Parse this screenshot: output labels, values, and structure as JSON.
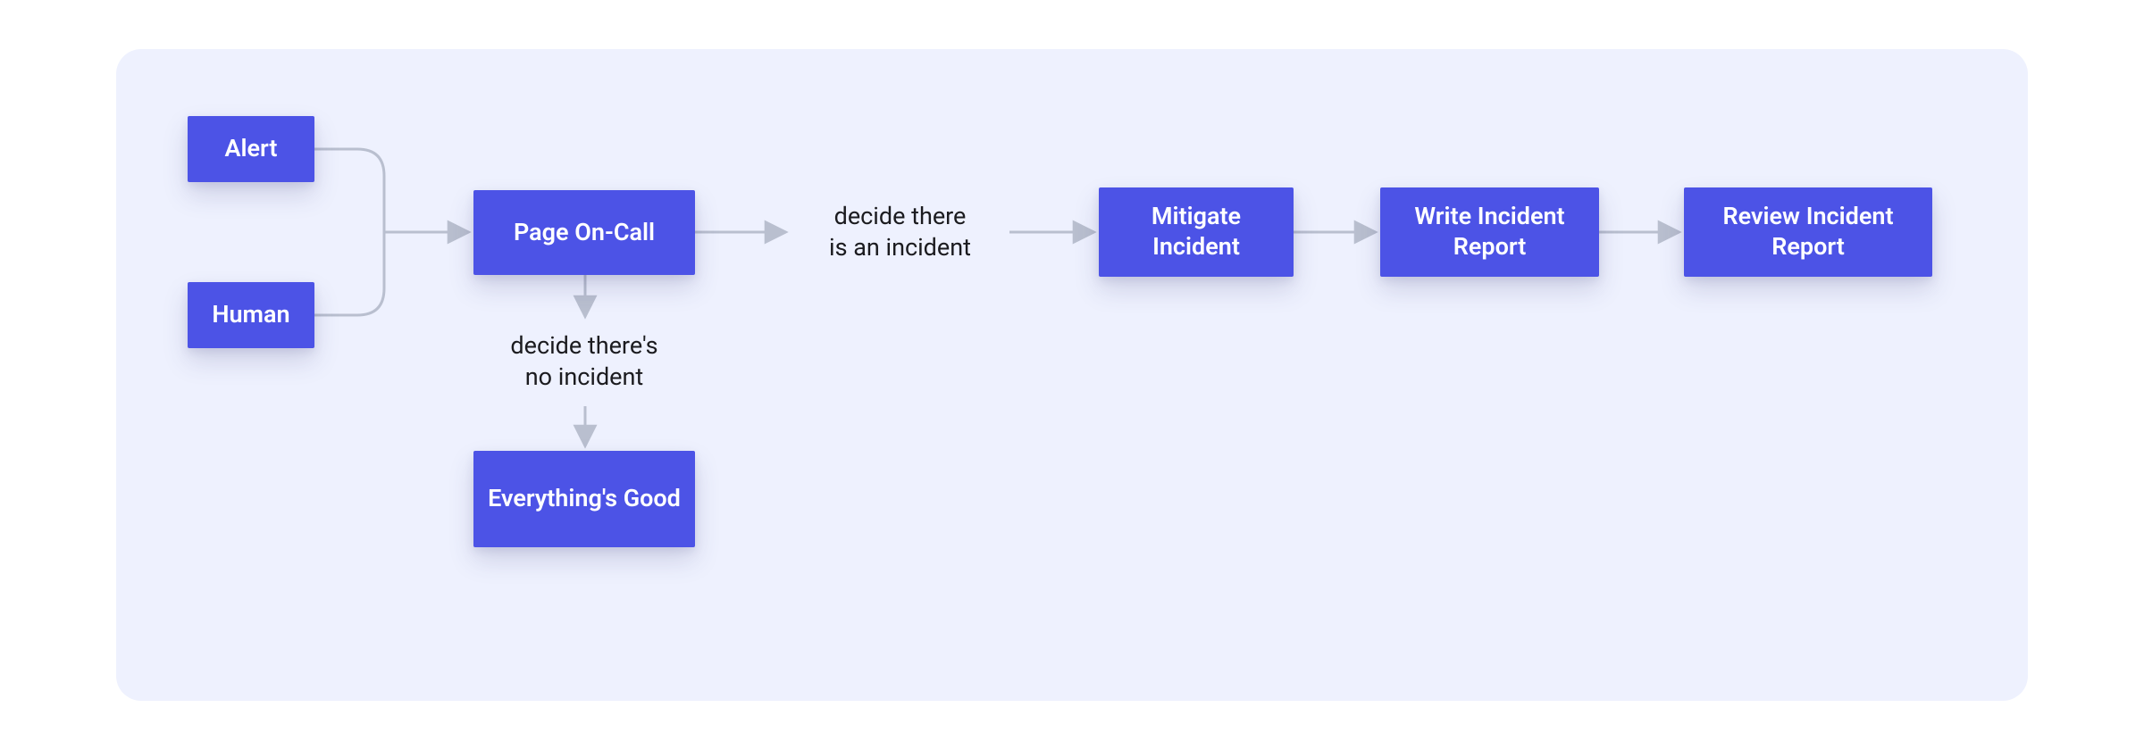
{
  "colors": {
    "panel_bg": "#EEF1FE",
    "node_bg": "#4C53E6",
    "node_text": "#FFFFFF",
    "label_text": "#1b1b1f",
    "connector": "#B9BFCF"
  },
  "nodes": {
    "alert": "Alert",
    "human": "Human",
    "page_on_call": "Page On-Call",
    "everythings_good": "Everything's\nGood",
    "mitigate_incident": "Mitigate\nIncident",
    "write_report": "Write Incident\nReport",
    "review_report": "Review Incident\nReport"
  },
  "edge_labels": {
    "no_incident": "decide there's\nno incident",
    "is_incident": "decide there\nis an incident"
  },
  "chart_data": {
    "type": "flowchart",
    "nodes": [
      {
        "id": "alert",
        "label": "Alert"
      },
      {
        "id": "human",
        "label": "Human"
      },
      {
        "id": "page_on_call",
        "label": "Page On-Call"
      },
      {
        "id": "everythings_good",
        "label": "Everything's Good"
      },
      {
        "id": "mitigate_incident",
        "label": "Mitigate Incident"
      },
      {
        "id": "write_report",
        "label": "Write Incident Report"
      },
      {
        "id": "review_report",
        "label": "Review Incident Report"
      }
    ],
    "edges": [
      {
        "from": "alert",
        "to": "page_on_call"
      },
      {
        "from": "human",
        "to": "page_on_call"
      },
      {
        "from": "page_on_call",
        "to": "everythings_good",
        "label": "decide there's no incident"
      },
      {
        "from": "page_on_call",
        "to": "mitigate_incident",
        "label": "decide there is an incident"
      },
      {
        "from": "mitigate_incident",
        "to": "write_report"
      },
      {
        "from": "write_report",
        "to": "review_report"
      }
    ]
  }
}
